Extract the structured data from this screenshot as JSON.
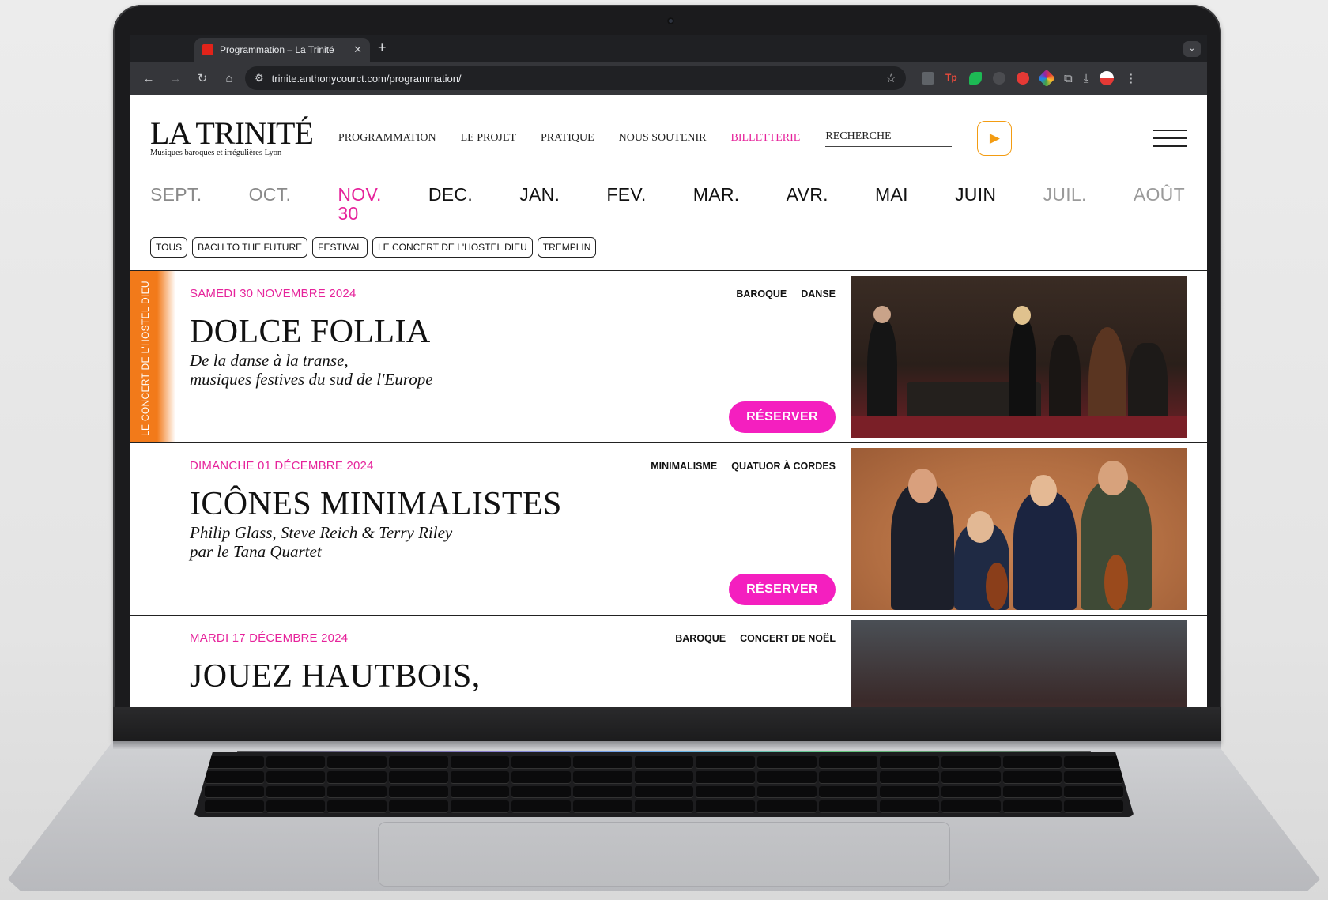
{
  "browser": {
    "tab_title": "Programmation – La Trinité",
    "new_tab": "+",
    "url": "trinite.anthonycourct.com/programmation/"
  },
  "site": {
    "logo_name": "LA TRINITÉ",
    "logo_tagline": "Musiques baroques et irrégulières  Lyon",
    "nav": {
      "programmation": "PROGRAMMATION",
      "projet": "LE PROJET",
      "pratique": "PRATIQUE",
      "soutenir": "NOUS SOUTENIR",
      "billetterie": "BILLETTERIE"
    },
    "search_label": "RECHERCHE",
    "months": {
      "sept": "SEPT.",
      "oct": "OCT.",
      "nov": "NOV.",
      "nov_day": "30",
      "dec": "DEC.",
      "jan": "JAN.",
      "fev": "FEV.",
      "mar": "MAR.",
      "avr": "AVR.",
      "mai": "MAI",
      "juin": "JUIN",
      "juil": "JUIL.",
      "aout": "AOÛT"
    },
    "filters": {
      "tous": "TOUS",
      "bach": "BACH TO THE FUTURE",
      "festival": "FESTIVAL",
      "hostel": "LE CONCERT DE L'HOSTEL DIEU",
      "tremplin": "TREMPLIN"
    },
    "events": [
      {
        "side_label": "LE CONCERT DE L'HOSTEL DIEU",
        "date": "SAMEDI 30 NOVEMBRE 2024",
        "title": "DOLCE FOLLIA",
        "subtitle_1": "De la danse à la transe,",
        "subtitle_2": "musiques festives du sud de l'Europe",
        "tag_1": "BAROQUE",
        "tag_2": "DANSE",
        "cta": "RÉSERVER"
      },
      {
        "date": "DIMANCHE 01 DÉCEMBRE 2024",
        "title": "ICÔNES MINIMALISTES",
        "subtitle_1": "Philip Glass, Steve Reich & Terry Riley",
        "subtitle_2": "par le Tana Quartet",
        "tag_1": "MINIMALISME",
        "tag_2": "QUATUOR À CORDES",
        "cta": "RÉSERVER"
      },
      {
        "date": "MARDI 17 DÉCEMBRE 2024",
        "title": "JOUEZ HAUTBOIS,",
        "tag_1": "BAROQUE",
        "tag_2": "CONCERT DE NOËL"
      }
    ]
  },
  "colors": {
    "accent_pink": "#e6239b",
    "button_pink": "#f41fbf",
    "orange": "#f27a1a"
  }
}
